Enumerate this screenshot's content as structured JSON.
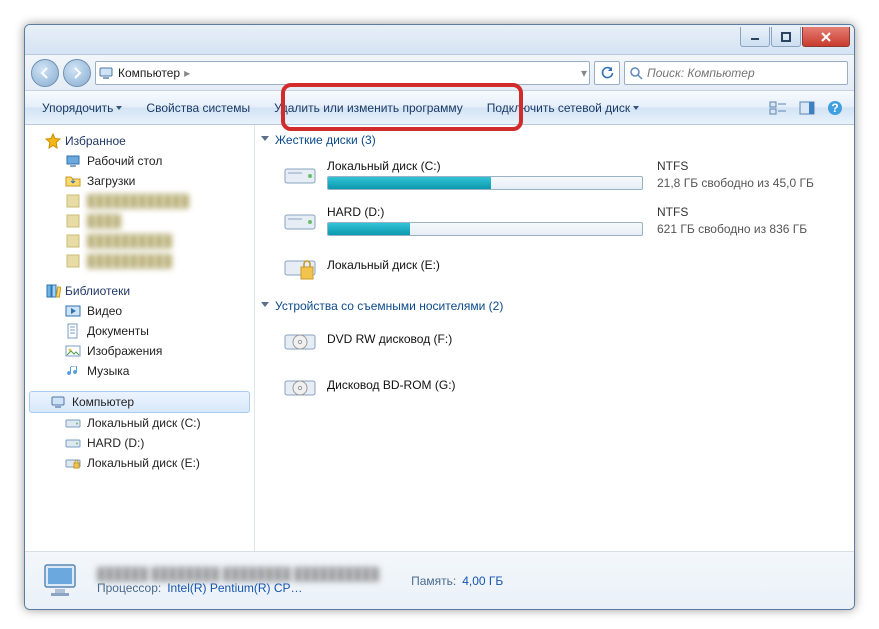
{
  "titlebar": {
    "minimize_tip": "Свернуть",
    "maximize_tip": "Развернуть",
    "close_tip": "Закрыть"
  },
  "address": {
    "root_icon": "computer-icon",
    "crumb1": "Компьютер"
  },
  "search": {
    "placeholder": "Поиск: Компьютер"
  },
  "toolbar": {
    "organize": "Упорядочить",
    "sys_props": "Свойства системы",
    "uninstall": "Удалить или изменить программу",
    "map_drive": "Подключить сетевой диск"
  },
  "tree": {
    "favorites": {
      "label": "Избранное",
      "items": [
        {
          "label": "Рабочий стол",
          "icon": "desktop-icon"
        },
        {
          "label": "Загрузки",
          "icon": "downloads-icon"
        },
        {
          "label": "████████████",
          "icon": "blur-icon",
          "blur": true
        },
        {
          "label": "████",
          "icon": "blur-icon",
          "blur": true
        },
        {
          "label": "██████████",
          "icon": "blur-icon",
          "blur": true
        },
        {
          "label": "██████████",
          "icon": "blur-icon",
          "blur": true
        }
      ]
    },
    "libraries": {
      "label": "Библиотеки",
      "items": [
        {
          "label": "Видео",
          "icon": "video-icon"
        },
        {
          "label": "Документы",
          "icon": "documents-icon"
        },
        {
          "label": "Изображения",
          "icon": "pictures-icon"
        },
        {
          "label": "Музыка",
          "icon": "music-icon"
        }
      ]
    },
    "computer": {
      "label": "Компьютер",
      "items": [
        {
          "label": "Локальный диск (C:)",
          "icon": "hdd-icon"
        },
        {
          "label": "HARD (D:)",
          "icon": "hdd-icon"
        },
        {
          "label": "Локальный диск (E:)",
          "icon": "hdd-lock-icon"
        }
      ]
    }
  },
  "main": {
    "hdd_section": "Жесткие диски (3)",
    "removable_section": "Устройства со съемными носителями (2)",
    "drives": [
      {
        "name": "Локальный диск (C:)",
        "fs": "NTFS",
        "free_text": "21,8 ГБ свободно из 45,0 ГБ",
        "used_pct": 52
      },
      {
        "name": "HARD (D:)",
        "fs": "NTFS",
        "free_text": "621 ГБ свободно из 836 ГБ",
        "used_pct": 26
      },
      {
        "name": "Локальный диск (E:)",
        "fs": "",
        "free_text": "",
        "used_pct": null,
        "locked": true
      }
    ],
    "removables": [
      {
        "name": "DVD RW дисковод (F:)"
      },
      {
        "name": "Дисковод BD-ROM (G:)"
      }
    ]
  },
  "details": {
    "line1_blur": "██████ ████████ ████████ ██████████",
    "cpu_label": "Процессор:",
    "cpu_value": "Intel(R) Pentium(R) CP…",
    "mem_label": "Память:",
    "mem_value": "4,00 ГБ"
  }
}
